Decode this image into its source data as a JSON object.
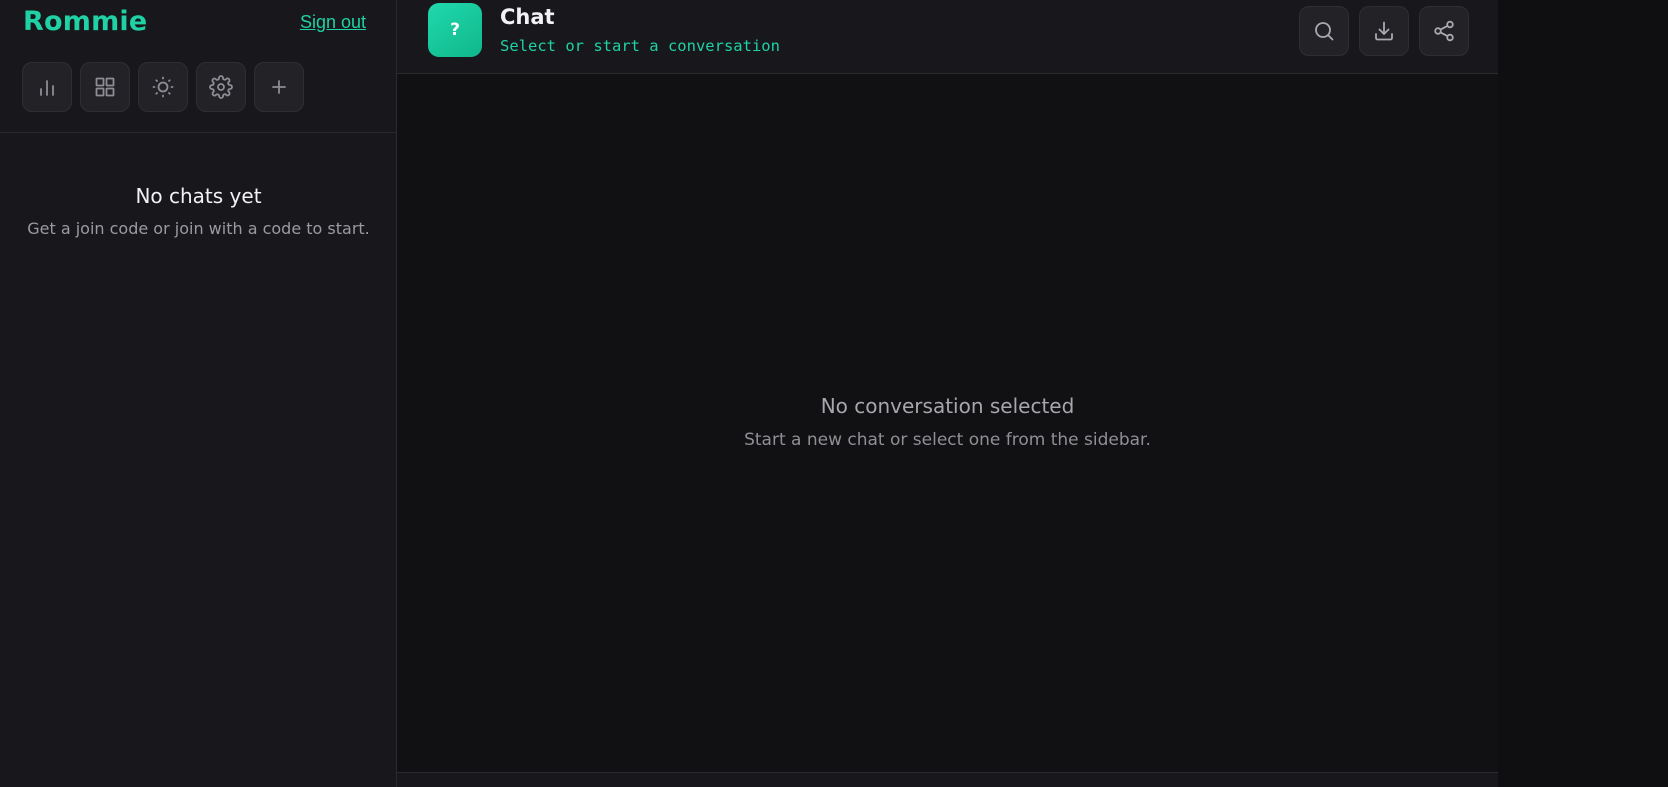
{
  "sidebar": {
    "brand": "Rommie",
    "signout_label": "Sign out",
    "tools": [
      {
        "icon": "bar-chart-icon"
      },
      {
        "icon": "grid-icon"
      },
      {
        "icon": "sun-icon"
      },
      {
        "icon": "gear-icon"
      },
      {
        "icon": "plus-icon"
      }
    ],
    "empty": {
      "title": "No chats yet",
      "subtitle": "Get a join code or join with a code to start."
    }
  },
  "header": {
    "avatar_glyph": "?",
    "title": "Chat",
    "subtitle": "Select or start a conversation",
    "actions": [
      {
        "icon": "search-icon"
      },
      {
        "icon": "download-icon"
      },
      {
        "icon": "share-icon"
      }
    ]
  },
  "main": {
    "empty": {
      "title": "No conversation selected",
      "subtitle": "Start a new chat or select one from the sidebar."
    }
  },
  "colors": {
    "accent": "#1fd1a4",
    "sidebar_bg": "#18181c",
    "main_bg": "#111113"
  }
}
